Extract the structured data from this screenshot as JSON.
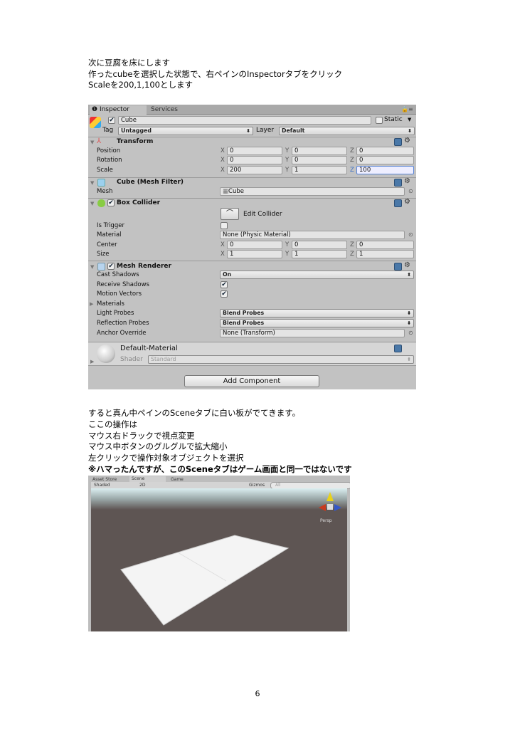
{
  "intro": [
    "次に豆腐を床にします",
    "作ったcubeを選択した状態で、右ペインのInspectorタブをクリック",
    "Scaleを200,1,100とします"
  ],
  "inspector": {
    "tabs": [
      "Inspector",
      "Services"
    ],
    "object_name": "Cube",
    "static_label": "Static",
    "tag_label": "Tag",
    "tag_value": "Untagged",
    "layer_label": "Layer",
    "layer_value": "Default",
    "transform": {
      "title": "Transform",
      "rows": [
        {
          "label": "Position",
          "x": "0",
          "y": "0",
          "z": "0"
        },
        {
          "label": "Rotation",
          "x": "0",
          "y": "0",
          "z": "0"
        },
        {
          "label": "Scale",
          "x": "200",
          "y": "1",
          "z": "100"
        }
      ]
    },
    "mesh_filter": {
      "title": "Cube (Mesh Filter)",
      "mesh_label": "Mesh",
      "mesh_value": "Cube"
    },
    "box_collider": {
      "title": "Box Collider",
      "edit_label": "Edit Collider",
      "is_trigger": "Is Trigger",
      "material_label": "Material",
      "material_value": "None (Physic Material)",
      "center": {
        "label": "Center",
        "x": "0",
        "y": "0",
        "z": "0"
      },
      "size": {
        "label": "Size",
        "x": "1",
        "y": "1",
        "z": "1"
      }
    },
    "mesh_renderer": {
      "title": "Mesh Renderer",
      "cast_label": "Cast Shadows",
      "cast_value": "On",
      "receive_label": "Receive Shadows",
      "motion_label": "Motion Vectors",
      "materials_label": "Materials",
      "light_label": "Light Probes",
      "light_value": "Blend Probes",
      "refl_label": "Reflection Probes",
      "refl_value": "Blend Probes",
      "anchor_label": "Anchor Override",
      "anchor_value": "None (Transform)"
    },
    "material": {
      "name": "Default-Material",
      "shader_label": "Shader",
      "shader_value": "Standard"
    },
    "add_component": "Add Component",
    "axes": {
      "x": "X",
      "y": "Y",
      "z": "Z"
    }
  },
  "body": [
    "すると真ん中ペインのSceneタブに白い板がでてきます。",
    "ここの操作は",
    "マウス右ドラックで視点変更",
    "マウス中ボタンのグルグルで拡大縮小",
    "左クリックで操作対象オブジェクトを選択"
  ],
  "note": "※ハマったんですが、このSceneタブはゲーム画面と同一ではないです",
  "scene": {
    "tabs": [
      "Asset Store",
      "Scene",
      "Game"
    ],
    "shading": "Shaded",
    "mode_2d": "2D",
    "gizmos": "Gizmos",
    "search_placeholder": "All",
    "persp": "Persp"
  },
  "page_number": "6"
}
